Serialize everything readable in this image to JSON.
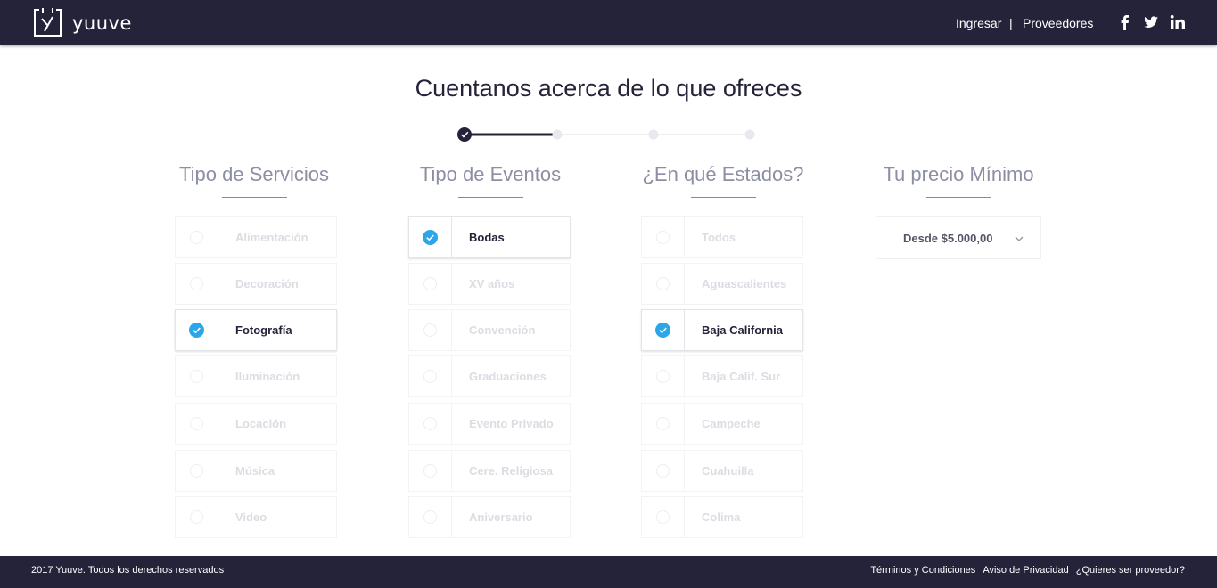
{
  "header": {
    "brand": "yuuve",
    "nav": {
      "login": "Ingresar",
      "separator": "|",
      "providers": "Proveedores"
    }
  },
  "page": {
    "title": "Cuentanos acerca de lo que ofreces"
  },
  "stepper": {
    "total_steps": 4,
    "completed_steps": 1
  },
  "columns": {
    "services": {
      "title": "Tipo de Servicios",
      "options": [
        {
          "label": "Alimentación",
          "selected": false
        },
        {
          "label": "Decoración",
          "selected": false
        },
        {
          "label": "Fotografía",
          "selected": true
        },
        {
          "label": "Iluminación",
          "selected": false
        },
        {
          "label": "Locación",
          "selected": false
        },
        {
          "label": "Música",
          "selected": false
        },
        {
          "label": "Video",
          "selected": false
        }
      ]
    },
    "events": {
      "title": "Tipo de Eventos",
      "options": [
        {
          "label": "Bodas",
          "selected": true
        },
        {
          "label": "XV años",
          "selected": false
        },
        {
          "label": "Convención",
          "selected": false
        },
        {
          "label": "Graduaciones",
          "selected": false
        },
        {
          "label": "Evento Privado",
          "selected": false
        },
        {
          "label": "Cere. Religiosa",
          "selected": false
        },
        {
          "label": "Aniversario",
          "selected": false
        }
      ]
    },
    "states": {
      "title": "¿En qué Estados?",
      "options": [
        {
          "label": "Todos",
          "selected": false
        },
        {
          "label": "Aguascalientes",
          "selected": false
        },
        {
          "label": "Baja California",
          "selected": true
        },
        {
          "label": "Baja Calif. Sur",
          "selected": false
        },
        {
          "label": "Campeche",
          "selected": false
        },
        {
          "label": "Cuahuilla",
          "selected": false
        },
        {
          "label": "Colima",
          "selected": false
        }
      ]
    },
    "price": {
      "title": "Tu precio Mínimo",
      "selected": "Desde $5.000,00"
    }
  },
  "footer": {
    "copyright": "2017 Yuuve.  Todos los derechos reservados",
    "links": [
      "Términos y Condiciones",
      "Aviso de Privacidad",
      "¿Quieres ser proveedor?"
    ]
  },
  "colors": {
    "navy": "#24233a",
    "accent": "#2ba6e8",
    "muted_text": "#dcdde3"
  }
}
